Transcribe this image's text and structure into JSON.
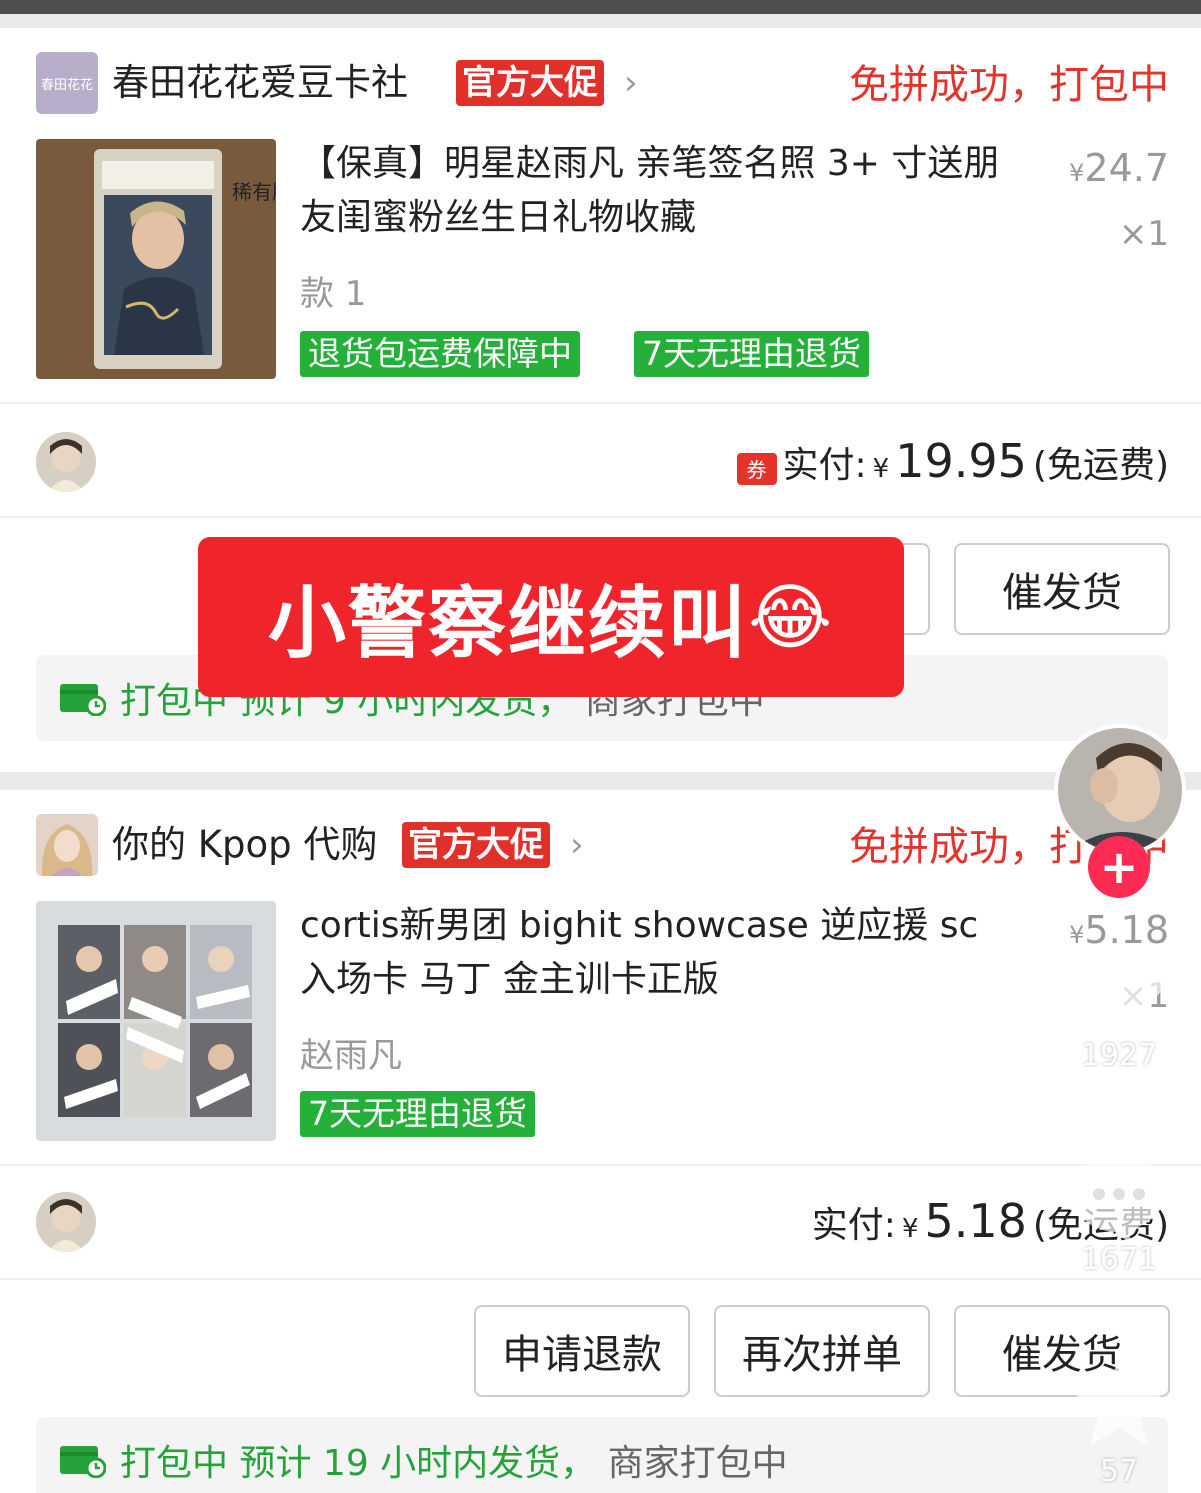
{
  "orders": [
    {
      "store_name": "春田花花爱豆卡社",
      "store_avatar_text": "春田花花",
      "promo_badge": "官方大促",
      "status": "免拼成功，打包中",
      "product_title": "【保真】明星赵雨凡 亲笔签名照 3+ 寸送朋友闺蜜粉丝生日礼物收藏",
      "thumb_text": "稀有版",
      "variant": "款 1",
      "tags": [
        "退货包运费保障中",
        "7天无理由退货"
      ],
      "price_symbol": "¥",
      "price": "24.7",
      "quantity": "×1",
      "coupon_label": "券",
      "paid_label": "实付:",
      "paid_symbol": "¥",
      "paid_amount": "19.95",
      "shipping_note": "(免运费)",
      "buttons": [
        "催发货"
      ],
      "ship_status": "打包中",
      "ship_eta": "预计 9 小时内发货，",
      "ship_detail": "商家打包中"
    },
    {
      "store_name": "你的 Kpop 代购",
      "promo_badge": "官方大促",
      "status": "免拼成功，打包中",
      "product_title": "cortis新男团 bighit showcase 逆应援 sc 入场卡 马丁 金主训卡正版",
      "variant": "赵雨凡",
      "tags": [
        "7天无理由退货"
      ],
      "price_symbol": "¥",
      "price": "5.18",
      "quantity": "×1",
      "paid_label": "实付:",
      "paid_symbol": "¥",
      "paid_amount": "5.18",
      "shipping_note": "(免运费)",
      "buttons": [
        "申请退款",
        "再次拼单",
        "催发货"
      ],
      "ship_status": "打包中",
      "ship_eta": "预计 19 小时内发货，",
      "ship_detail": "商家打包中"
    }
  ],
  "overlay": {
    "caption": "小警察继续叫",
    "emoji": "😂"
  },
  "sidebar": {
    "follow_label": "+",
    "like_count": "1927",
    "comment_count": "1671",
    "favorite_count": "57"
  },
  "colors": {
    "accent_red": "#e5332c",
    "tag_green": "#25b03a",
    "overlay_red": "#f0242b"
  }
}
